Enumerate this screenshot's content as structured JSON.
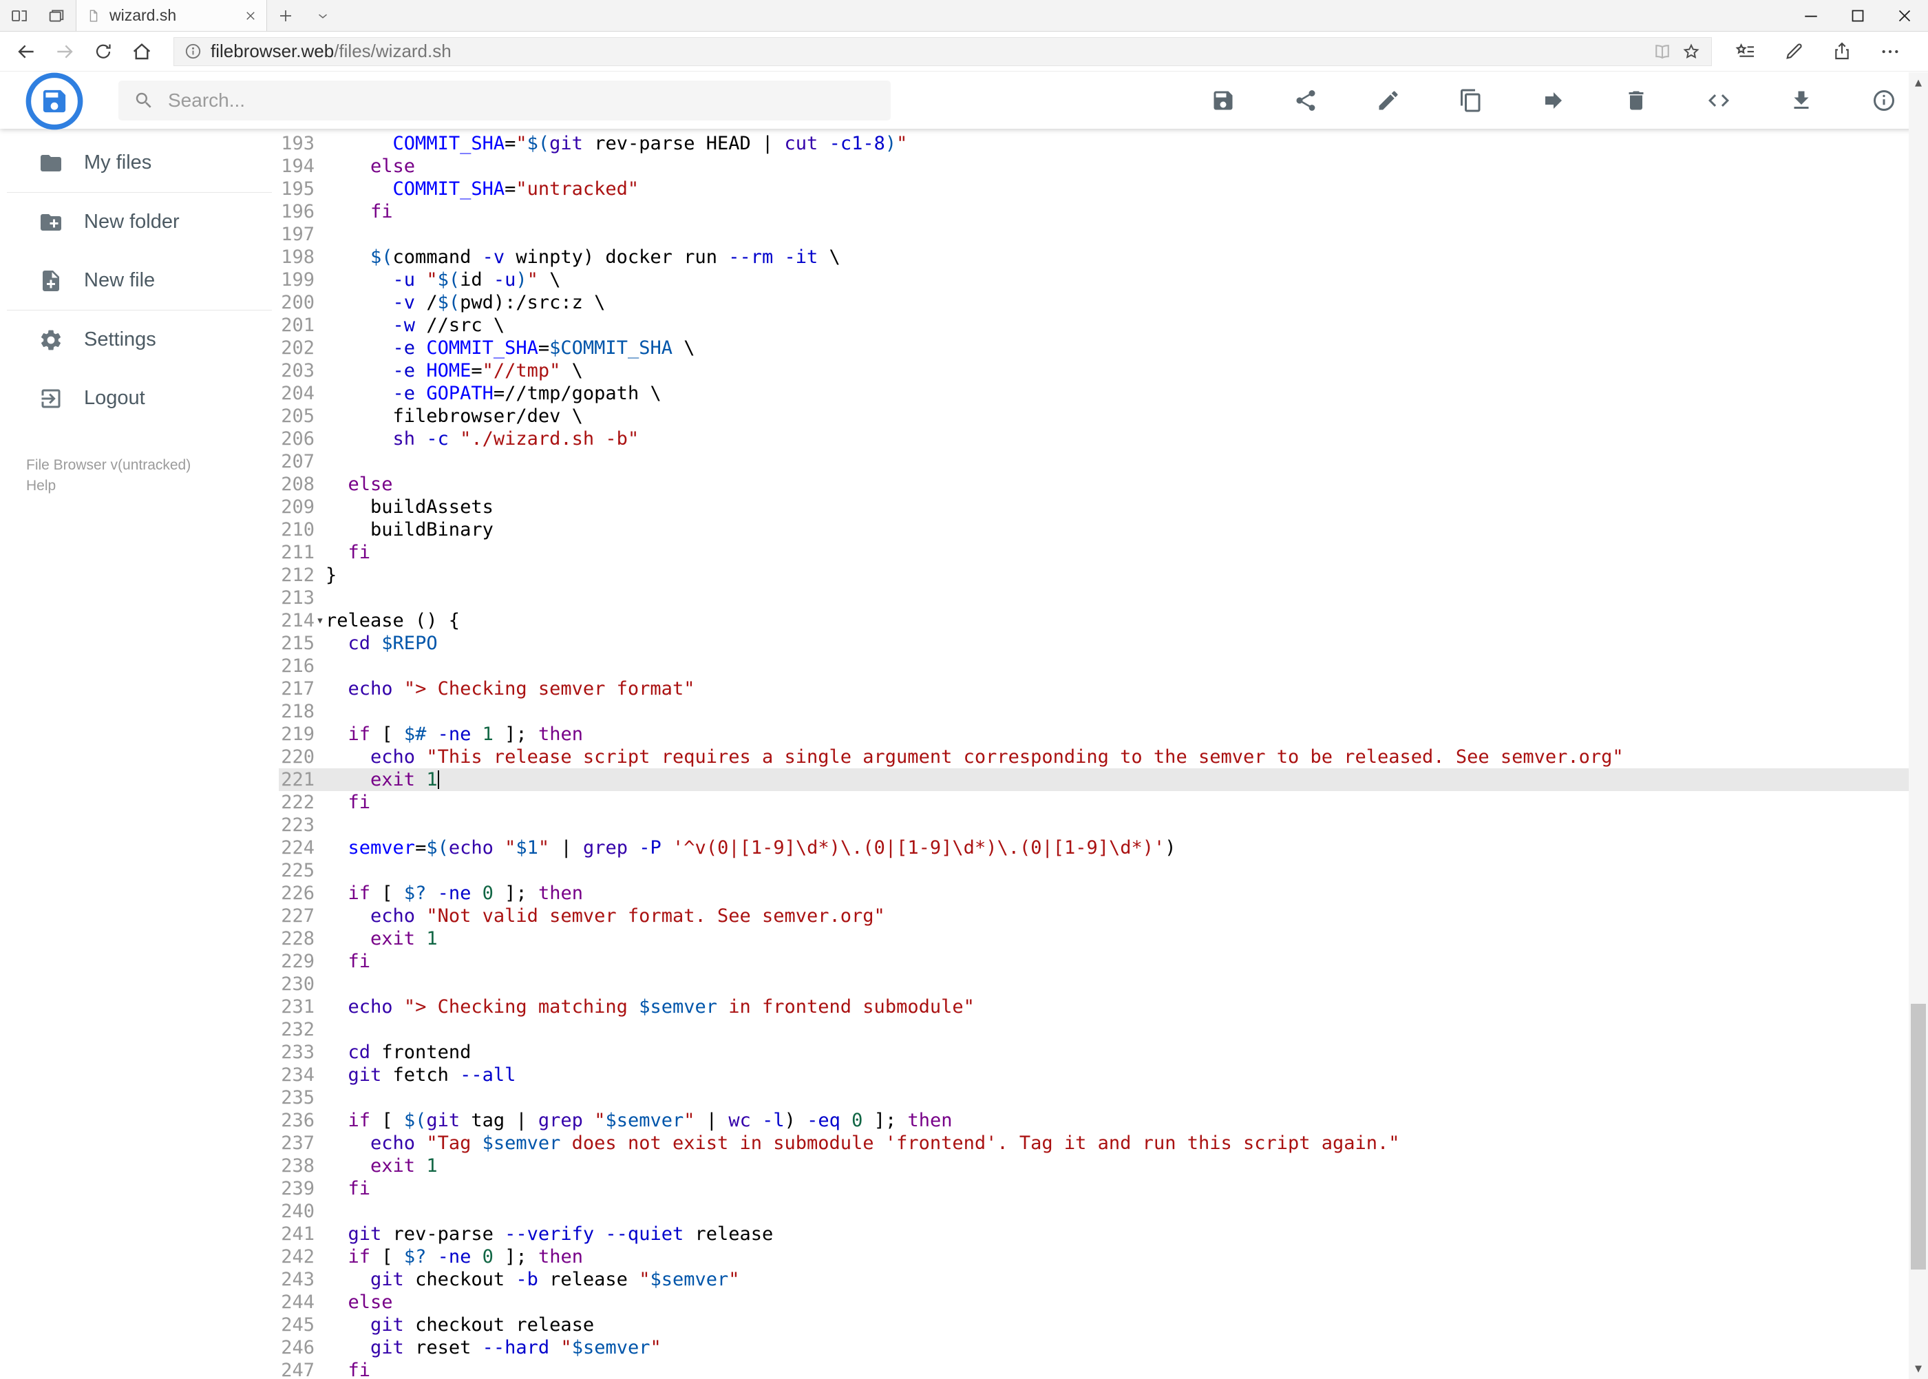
{
  "colors": {
    "accent": "#2f7fe0",
    "icon_gray": "#5c6870",
    "sidebar_text": "#4c5a63",
    "gutter": "#999999",
    "active_line_bg": "#e8e8e8",
    "syn_keyword": "#770088",
    "syn_builtin": "#3300aa",
    "syn_string": "#aa1111",
    "syn_variable": "#0055aa",
    "syn_attribute": "#0000cc",
    "syn_number": "#116644",
    "syn_def": "#0000ff"
  },
  "browser": {
    "tab_title": "wizard.sh",
    "url_domain": "filebrowser.web",
    "url_path": "/files/wizard.sh"
  },
  "header": {
    "search_placeholder": "Search..."
  },
  "sidebar": {
    "items": [
      {
        "label": "My files"
      },
      {
        "label": "New folder"
      },
      {
        "label": "New file"
      },
      {
        "label": "Settings"
      },
      {
        "label": "Logout"
      }
    ],
    "version": "File Browser v(untracked)",
    "help": "Help"
  },
  "icons": {
    "fold_open": "▾",
    "scroll_up": "▲",
    "scroll_down": "▼"
  },
  "editor": {
    "first_line": 193,
    "active_line": 221,
    "fold_line": 214,
    "cursor": {
      "line": 221,
      "col": 10
    },
    "lines": [
      "      COMMIT_SHA=\"$(git rev-parse HEAD | cut -c1-8)\"",
      "    else",
      "      COMMIT_SHA=\"untracked\"",
      "    fi",
      "",
      "    $(command -v winpty) docker run --rm -it \\",
      "      -u \"$(id -u)\" \\",
      "      -v /$(pwd):/src:z \\",
      "      -w //src \\",
      "      -e COMMIT_SHA=$COMMIT_SHA \\",
      "      -e HOME=\"//tmp\" \\",
      "      -e GOPATH=//tmp/gopath \\",
      "      filebrowser/dev \\",
      "      sh -c \"./wizard.sh -b\"",
      "",
      "  else",
      "    buildAssets",
      "    buildBinary",
      "  fi",
      "}",
      "",
      "release () {",
      "  cd $REPO",
      "",
      "  echo \"> Checking semver format\"",
      "",
      "  if [ $# -ne 1 ]; then",
      "    echo \"This release script requires a single argument corresponding to the semver to be released. See semver.org\"",
      "    exit 1",
      "  fi",
      "",
      "  semver=$(echo \"$1\" | grep -P '^v(0|[1-9]\\d*)\\.(0|[1-9]\\d*)\\.(0|[1-9]\\d*)')",
      "",
      "  if [ $? -ne 0 ]; then",
      "    echo \"Not valid semver format. See semver.org\"",
      "    exit 1",
      "  fi",
      "",
      "  echo \"> Checking matching $semver in frontend submodule\"",
      "",
      "  cd frontend",
      "  git fetch --all",
      "",
      "  if [ $(git tag | grep \"$semver\" | wc -l) -eq 0 ]; then",
      "    echo \"Tag $semver does not exist in submodule 'frontend'. Tag it and run this script again.\"",
      "    exit 1",
      "  fi",
      "",
      "  git rev-parse --verify --quiet release",
      "  if [ $? -ne 0 ]; then",
      "    git checkout -b release \"$semver\"",
      "  else",
      "    git checkout release",
      "    git reset --hard \"$semver\"",
      "  fi"
    ]
  }
}
